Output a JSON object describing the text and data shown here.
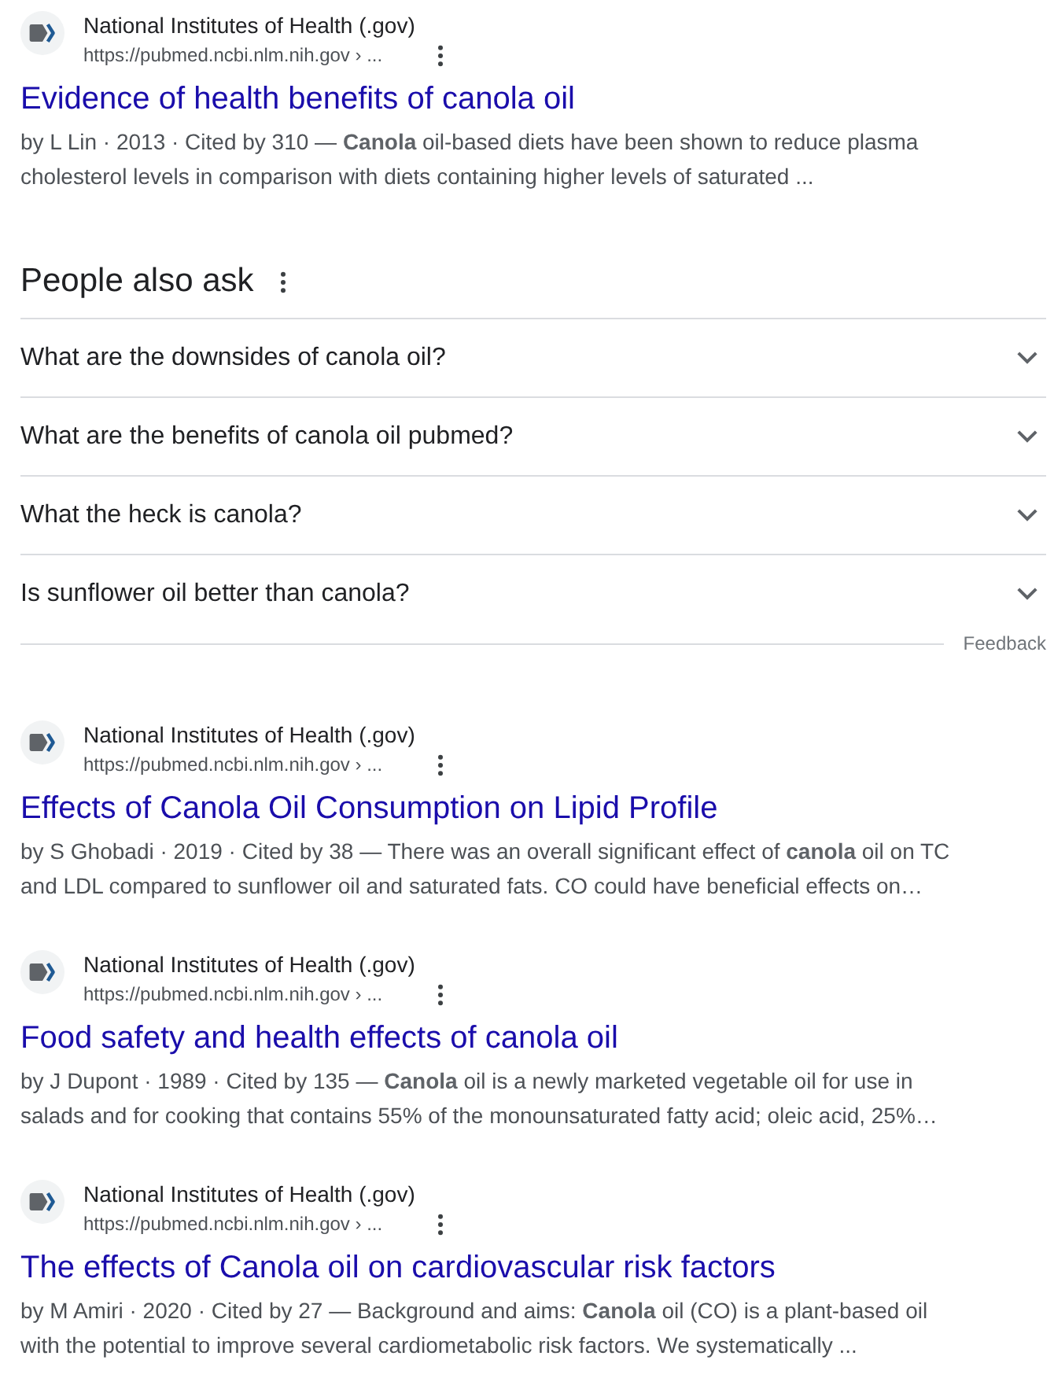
{
  "blocks": [
    {
      "kind": "result",
      "site": "National Institutes of Health (.gov)",
      "url": "https://pubmed.ncbi.nlm.nih.gov › ...",
      "title": "Evidence of health benefits of canola oil",
      "snippet": "by L Lin · 2013 · Cited by 310 — **Canola** oil-based diets have been shown to reduce plasma cholesterol levels in comparison with diets containing higher levels of saturated ..."
    },
    {
      "kind": "people_also_ask",
      "title": "People also ask",
      "questions": [
        {
          "text": "What are the downsides of canola oil?",
          "expanded": false
        },
        {
          "text": "What are the benefits of canola oil pubmed?",
          "expanded": false
        },
        {
          "text": "What the heck is canola?",
          "expanded": false
        },
        {
          "text": "Is sunflower oil better than canola?",
          "expanded": false
        }
      ],
      "feedback": "Feedback"
    },
    {
      "kind": "result",
      "site": "National Institutes of Health (.gov)",
      "url": "https://pubmed.ncbi.nlm.nih.gov › ...",
      "title": "Effects of Canola Oil Consumption on Lipid Profile",
      "snippet": "by S Ghobadi · 2019 · Cited by 38 — There was an overall significant effect of **canola** oil on TC and LDL compared to sunflower oil and saturated fats. CO could have beneficial effects on…"
    },
    {
      "kind": "result",
      "site": "National Institutes of Health (.gov)",
      "url": "https://pubmed.ncbi.nlm.nih.gov › ...",
      "title": "Food safety and health effects of canola oil",
      "snippet": "by J Dupont · 1989 · Cited by 135 — **Canola** oil is a newly marketed vegetable oil for use in salads and for cooking that contains 55% of the monounsaturated fatty acid; oleic acid, 25%…"
    },
    {
      "kind": "result",
      "site": "National Institutes of Health (.gov)",
      "url": "https://pubmed.ncbi.nlm.nih.gov › ...",
      "title": "The effects of Canola oil on cardiovascular risk factors",
      "snippet": "by M Amiri · 2020 · Cited by 27 — Background and aims: **Canola** oil (CO) is a plant-based oil with the potential to improve several cardiometabolic risk factors. We systematically ..."
    }
  ]
}
